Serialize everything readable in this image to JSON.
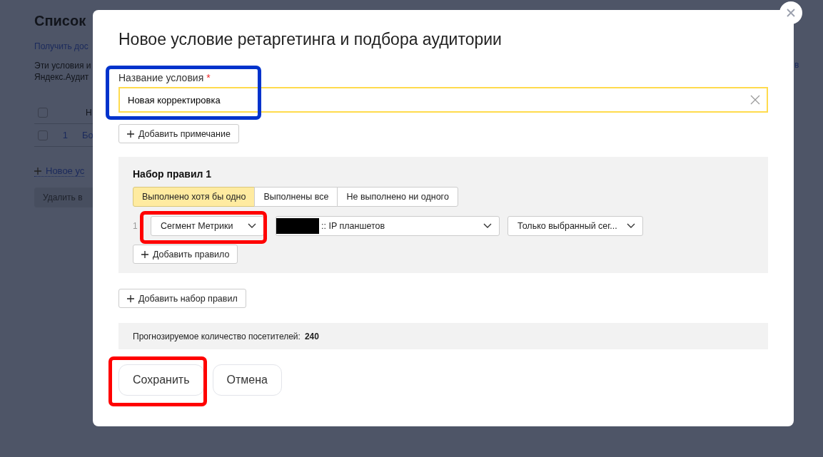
{
  "background_page": {
    "title": "Список",
    "link": "Получить дос",
    "description_lines": [
      "Эти условия и",
      "Яндекс.Аудит"
    ],
    "right_fragment": "в",
    "table": {
      "header": "Н",
      "rows": [
        {
          "number": "1",
          "name": "Бо",
          "checked": false
        }
      ],
      "header_checked": false
    },
    "new_link": "Новое ус",
    "delete_button": "Удалить в"
  },
  "dialog": {
    "title": "Новое условие ретаргетинга и подбора аудитории",
    "name_field": {
      "label": "Название условия",
      "required_mark": "*",
      "value": "Новая корректировка"
    },
    "add_note_button": "Добавить примечание",
    "rule_sets": [
      {
        "title": "Набор правил 1",
        "modes": [
          {
            "label": "Выполнено хотя бы одно",
            "selected": true
          },
          {
            "label": "Выполнены все",
            "selected": false
          },
          {
            "label": "Не выполнено ни одного",
            "selected": false
          }
        ],
        "rules": [
          {
            "number": "1",
            "type": "Сегмент Метрики",
            "segment": ":: IP планшетов",
            "redacted": true,
            "scope": "Только выбранный сег..."
          }
        ],
        "add_rule_button": "Добавить правило"
      }
    ],
    "add_rule_set_button": "Добавить набор правил",
    "forecast": {
      "label": "Прогнозируемое количество посетителей:",
      "value": "240"
    },
    "buttons": [
      "Сохранить",
      "Отмена"
    ]
  },
  "annotations": [
    {
      "color": "#0033cc"
    },
    {
      "color": "#ff0000"
    },
    {
      "color": "#ff0000"
    }
  ]
}
